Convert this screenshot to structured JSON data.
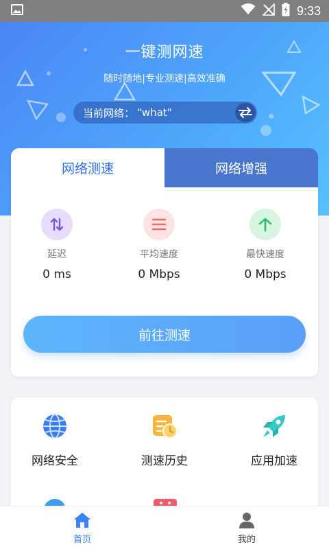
{
  "status_bar": {
    "time": "9:33"
  },
  "hero": {
    "title": "一键测网速",
    "subtitle": "随时随地|专业测速|高效准确",
    "network_label": "当前网络：",
    "network_value": "\"what\""
  },
  "tabs": [
    {
      "label": "网络测速",
      "active": true
    },
    {
      "label": "网络增强",
      "active": false
    }
  ],
  "metrics": [
    {
      "label": "延迟",
      "value": "0 ms",
      "color": "#7b57d8",
      "bg": "#e7dcfb"
    },
    {
      "label": "平均速度",
      "value": "0 Mbps",
      "color": "#ef6b6b",
      "bg": "#fde3e3"
    },
    {
      "label": "最快速度",
      "value": "0 Mbps",
      "color": "#2fbf6b",
      "bg": "#d8f5e2"
    }
  ],
  "go_button": {
    "label": "前往测速"
  },
  "features": [
    {
      "label": "网络安全",
      "icon": "globe-icon"
    },
    {
      "label": "测速历史",
      "icon": "history-clock-icon"
    },
    {
      "label": "应用加速",
      "icon": "rocket-icon"
    }
  ],
  "bottom_nav": [
    {
      "label": "首页",
      "icon": "home-icon",
      "active": true
    },
    {
      "label": "我的",
      "icon": "user-icon",
      "active": false
    }
  ],
  "colors": {
    "accent": "#3b82f6",
    "hero_gradient_start": "#4a86f5",
    "hero_gradient_end": "#57c2ff",
    "button_gradient_start": "#5db6fb",
    "button_gradient_end": "#5a9ffa"
  }
}
